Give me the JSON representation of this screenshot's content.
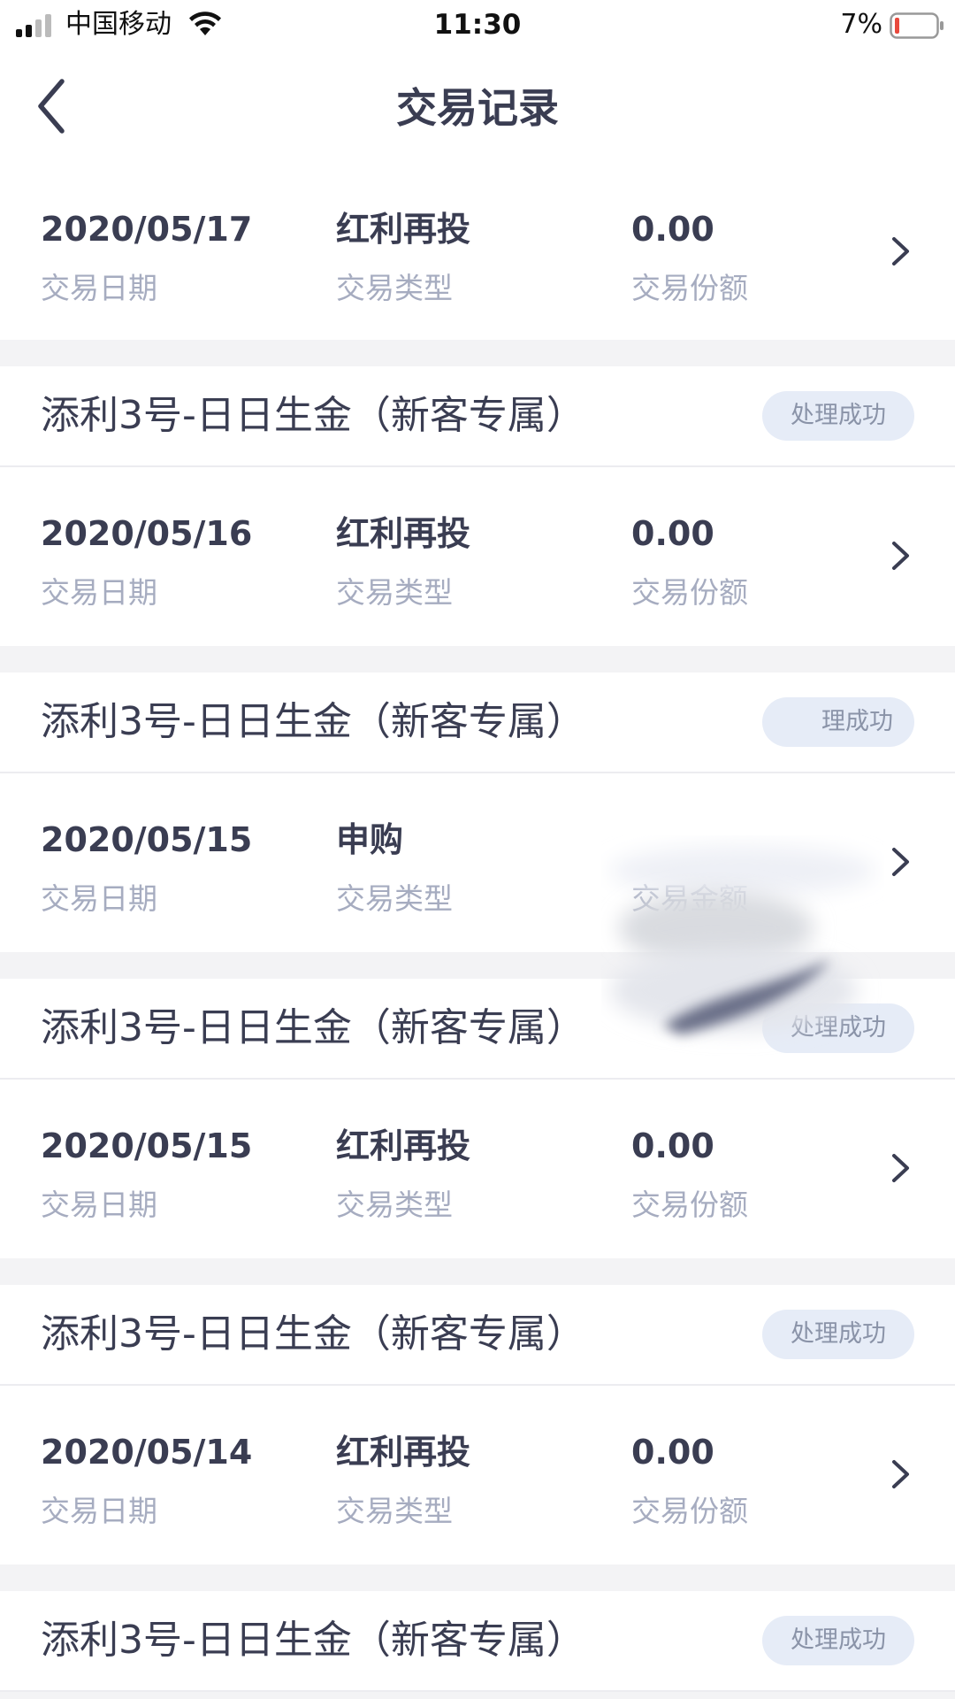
{
  "status_bar": {
    "carrier": "中国移动",
    "time": "11:30",
    "battery": "7%"
  },
  "nav": {
    "title": "交易记录",
    "back_icon": "chevron-left-icon"
  },
  "colors": {
    "text_primary": "#3a3d52",
    "text_secondary": "#a6acc0",
    "badge_bg": "#e6ecf7",
    "badge_text": "#8a93a8",
    "separator_bg": "#f3f3f5",
    "battery_low": "#e8493d"
  },
  "records": [
    {
      "product": "",
      "status": "",
      "date": "2020/05/17",
      "date_label": "交易日期",
      "type": "红利再投",
      "type_label": "交易类型",
      "amount": "0.00",
      "amount_label": "交易份额"
    },
    {
      "product": "添利3号-日日生金（新客专属）",
      "status": "处理成功",
      "date": "2020/05/16",
      "date_label": "交易日期",
      "type": "红利再投",
      "type_label": "交易类型",
      "amount": "0.00",
      "amount_label": "交易份额"
    },
    {
      "product": "添利3号-日日生金（新客专属）",
      "status": "理成功",
      "date": "2020/05/15",
      "date_label": "交易日期",
      "type": "申购",
      "type_label": "交易类型",
      "amount": "",
      "amount_label": "交易金额"
    },
    {
      "product": "添利3号-日日生金（新客专属）",
      "status": "处理成功",
      "date": "2020/05/15",
      "date_label": "交易日期",
      "type": "红利再投",
      "type_label": "交易类型",
      "amount": "0.00",
      "amount_label": "交易份额"
    },
    {
      "product": "添利3号-日日生金（新客专属）",
      "status": "处理成功",
      "date": "2020/05/14",
      "date_label": "交易日期",
      "type": "红利再投",
      "type_label": "交易类型",
      "amount": "0.00",
      "amount_label": "交易份额"
    },
    {
      "product": "添利3号-日日生金（新客专属）",
      "status": "处理成功"
    }
  ]
}
